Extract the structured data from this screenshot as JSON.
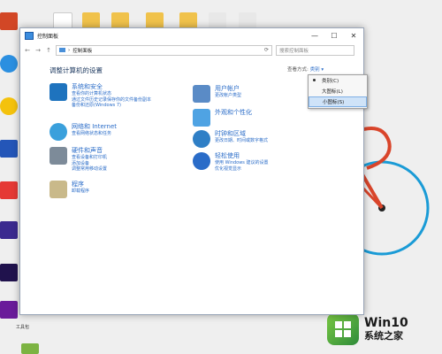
{
  "window": {
    "title": "控制面板",
    "minimize": "—",
    "maximize": "☐",
    "close": "✕"
  },
  "address": {
    "path": "控制面板",
    "separator": "›",
    "search_placeholder": "搜索控制面板"
  },
  "main": {
    "heading": "调整计算机的设置",
    "view_by_label": "查看方式:",
    "view_by_value": "类别 ▾"
  },
  "categories": [
    {
      "title": "系统和安全",
      "links": [
        "查看你的计算机状态",
        "通过文件历史记录保存你的文件备份副本",
        "备份和还原(Windows 7)"
      ]
    },
    {
      "title": "网络和 Internet",
      "links": [
        "查看网络状态和任务"
      ]
    },
    {
      "title": "硬件和声音",
      "links": [
        "查看设备和打印机",
        "添加设备",
        "调整常用移动设置"
      ]
    },
    {
      "title": "程序",
      "links": [
        "卸载程序"
      ]
    },
    {
      "title": "用户帐户",
      "links": [
        "更改帐户类型"
      ]
    },
    {
      "title": "外观和个性化",
      "links": []
    },
    {
      "title": "时钟和区域",
      "links": [
        "更改日期、时间或数字格式"
      ]
    },
    {
      "title": "轻松使用",
      "links": [
        "使用 Windows 建议的设置",
        "优化视觉显示"
      ]
    }
  ],
  "dropdown": {
    "items": [
      "类别(C)",
      "大图标(L)",
      "小图标(S)"
    ],
    "checked_index": 0,
    "highlighted_index": 2
  },
  "desktop": {
    "label": "工具包"
  },
  "watermark": {
    "line1": "Win10",
    "line2": "系统之家"
  },
  "colors": {
    "link": "#2a6cc8",
    "heading": "#1e3a60",
    "bike_frame": "#d9452b",
    "bike_wheel": "#1a9bd6",
    "watermark_green": "#4caf50"
  }
}
